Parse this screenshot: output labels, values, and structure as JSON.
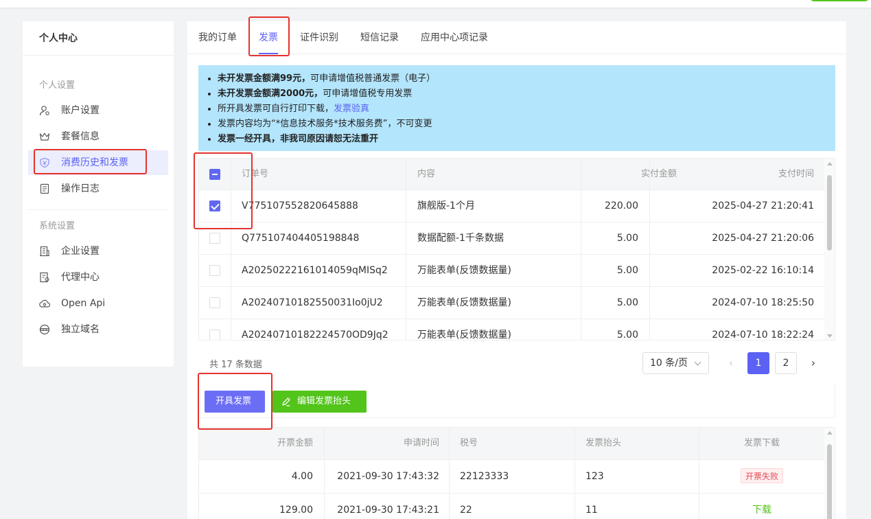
{
  "sidebar": {
    "title": "个人中心",
    "groups": [
      {
        "label": "个人设置",
        "items": [
          "账户设置",
          "套餐信息",
          "消费历史和发票",
          "操作日志"
        ]
      },
      {
        "label": "系统设置",
        "items": [
          "企业设置",
          "代理中心",
          "Open Api",
          "独立域名"
        ]
      }
    ]
  },
  "tabs": [
    "我的订单",
    "发票",
    "证件识别",
    "短信记录",
    "应用中心项记录"
  ],
  "active_tab": "发票",
  "notice": {
    "line1_bold": "未开发票金额满99元，",
    "line1_rest": "可申请增值税普通发票（电子）",
    "line2_bold": "未开发票金额满2000元，",
    "line2_rest": "可申请增值税专用发票",
    "line3_text": "所开具发票可自行打印下载，",
    "line3_link": "发票验真",
    "line4": "发票内容均为“*信息技术服务*技术服务费”，不可变更",
    "line5_bold": "发票一经开具，非我司原因请恕无法重开"
  },
  "orders_table": {
    "columns": [
      "订单号",
      "内容",
      "实付金额",
      "支付时间"
    ],
    "rows": [
      {
        "id": "V775107552820645888",
        "content": "旗舰版-1个月",
        "amount": "220.00",
        "time": "2025-04-27 21:20:41",
        "checked": true
      },
      {
        "id": "Q775107404405198848",
        "content": "数据配额-1千条数据",
        "amount": "5.00",
        "time": "2025-04-27 21:20:06",
        "checked": false
      },
      {
        "id": "A20250222161014059qMISq2",
        "content": "万能表单(反馈数据量)",
        "amount": "5.00",
        "time": "2025-02-22 16:10:14",
        "checked": false
      },
      {
        "id": "A20240710182550031Io0jU2",
        "content": "万能表单(反馈数据量)",
        "amount": "5.00",
        "time": "2024-07-10 18:25:50",
        "checked": false
      },
      {
        "id": "A20240710182224570OD9Jq2",
        "content": "万能表单(反馈数据量)",
        "amount": "5.00",
        "time": "2024-07-10 18:22:24",
        "checked": false
      }
    ]
  },
  "pagination": {
    "total_text": "共 17 条数据",
    "page_size": "10 条/页",
    "pages": [
      "1",
      "2"
    ],
    "current": "1"
  },
  "buttons": {
    "issue_invoice": "开具发票",
    "edit_header": "编辑发票抬头"
  },
  "invoice_table": {
    "columns": [
      "开票金额",
      "申请时间",
      "税号",
      "发票抬头",
      "发票下载"
    ],
    "rows": [
      {
        "amount": "4.00",
        "time": "2021-09-30 17:43:32",
        "tax_no": "22123333",
        "header": "123",
        "download": "开票失败",
        "status": "fail"
      },
      {
        "amount": "129.00",
        "time": "2021-09-30 17:43:21",
        "tax_no": "22",
        "header": "11",
        "download": "下载",
        "status": "ok"
      }
    ]
  },
  "colors": {
    "accent": "#5b61f3",
    "green": "#52c41a",
    "notice_bg": "#b3e5fc",
    "highlight": "#e5322d"
  }
}
